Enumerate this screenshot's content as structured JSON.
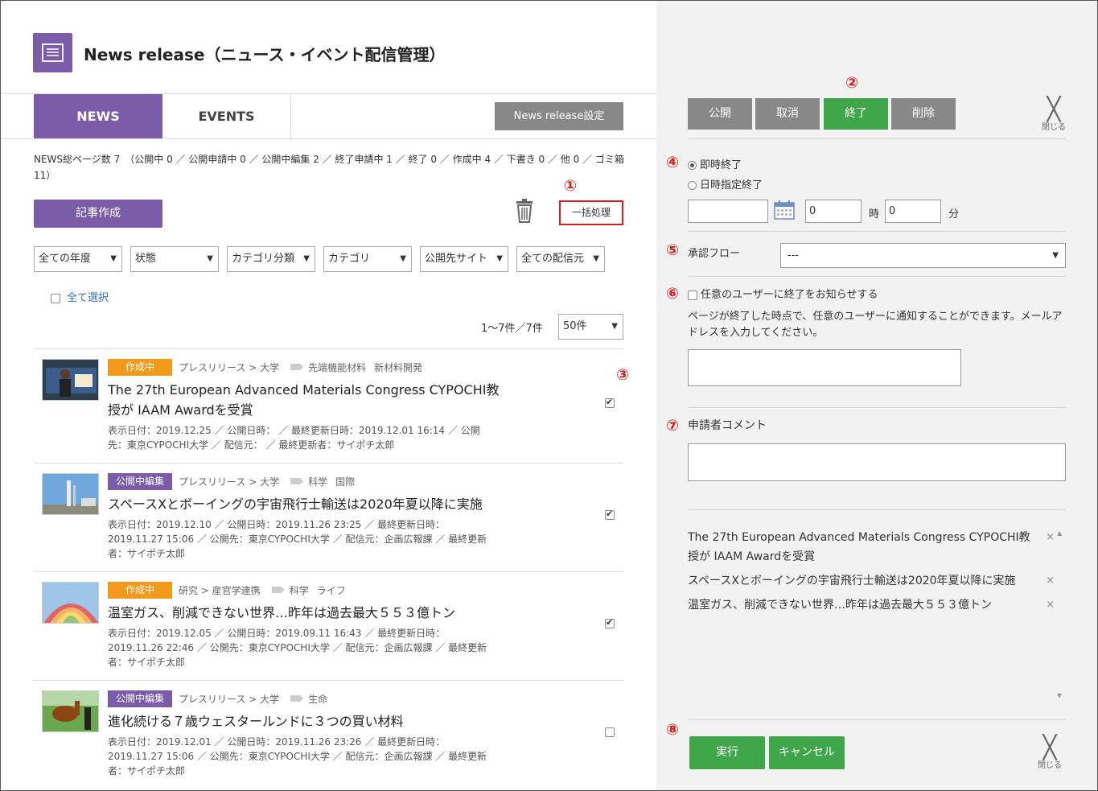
{
  "header": {
    "title": "News release（ニュース・イベント配信管理）"
  },
  "tabs": [
    {
      "label": "NEWS"
    },
    {
      "label": "EVENTS"
    }
  ],
  "settings_button": "News release設定",
  "summary": "NEWS総ページ数 7　（公開中 0 ／ 公開申請中 0 ／ 公開中編集 2 ／ 終了申請中 1 ／ 終了 0 ／ 作成中 4 ／ 下書き 0 ／ 他 0 ／ ゴミ箱 11）",
  "create_button": "記事作成",
  "bulk_button": "一括処理",
  "markers": [
    "①",
    "②",
    "③",
    "④",
    "⑤",
    "⑥",
    "⑦",
    "⑧"
  ],
  "filters": [
    "全ての年度",
    "状態",
    "カテゴリ分類",
    "カテゴリ",
    "公開先サイト",
    "全ての配信元"
  ],
  "select_all": "全て選択",
  "paging": {
    "text": "1〜7件／7件",
    "per_page": "50件"
  },
  "items": [
    {
      "status": "作成中",
      "status_color": "#f29a1b",
      "category": "プレスリリース > 大学",
      "tags": [
        "先端機能材料",
        "新材料開発"
      ],
      "title": "The 27th European Advanced Materials Congress CYPOCHI教授が IAAM Awardを受賞",
      "meta": "表示日付：2019.12.25 ／ 公開日時： ／ 最終更新日時：2019.12.01 16:14 ／ 公開先：東京CYPOCHI大学 ／ 配信元： ／ 最終更新者：サイポチ太郎",
      "checked": true
    },
    {
      "status": "公開中編集",
      "status_color": "#7b5ca8",
      "category": "プレスリリース > 大学",
      "tags": [
        "科学",
        "国際"
      ],
      "title": "スペースXとボーイングの宇宙飛行士輸送は2020年夏以降に実施",
      "meta": "表示日付：2019.12.10 ／ 公開日時：2019.11.26 23:25 ／ 最終更新日時：2019.11.27 15:06 ／ 公開先：東京CYPOCHI大学 ／ 配信元：企画広報課 ／ 最終更新者：サイポチ太郎",
      "checked": true
    },
    {
      "status": "作成中",
      "status_color": "#f29a1b",
      "category": "研究 > 産官学連携",
      "tags": [
        "科学",
        "ライフ"
      ],
      "title": "温室ガス、削減できない世界…昨年は過去最大５５３億トン",
      "meta": "表示日付：2019.12.05 ／ 公開日時：2019.09.11 16:43 ／ 最終更新日時：2019.11.26 22:46 ／ 公開先：東京CYPOCHI大学 ／ 配信元：企画広報課 ／ 最終更新者：サイポチ太郎",
      "checked": true
    },
    {
      "status": "公開中編集",
      "status_color": "#7b5ca8",
      "category": "プレスリリース > 大学",
      "tags": [
        "生命"
      ],
      "title": "進化続ける７歳ウェスタールンドに３つの買い材料",
      "meta": "表示日付：2019.12.01 ／ 公開日時：2019.11.26 23:26 ／ 最終更新日時：2019.11.27 15:06 ／ 公開先：東京CYPOCHI大学 ／ 配信元：企画広報課 ／ 最終更新者：サイポチ太郎",
      "checked": false
    }
  ],
  "panel": {
    "actions": [
      "公開",
      "取消",
      "終了",
      "削除"
    ],
    "close_label": "閉じる",
    "end_options": [
      "即時終了",
      "日時指定終了"
    ],
    "hour_value": "0",
    "hour_unit": "時",
    "minute_value": "0",
    "minute_unit": "分",
    "flow_label": "承認フロー",
    "flow_value": "---",
    "notify_label": "任意のユーザーに終了をお知らせする",
    "notify_help": "ページが終了した時点で、任意のユーザーに通知することができます。メールアドレスを入力してください。",
    "comment_label": "申請者コメント",
    "selected": [
      "The 27th European Advanced Materials Congress CYPOCHI教授が IAAM Awardを受賞",
      "スペースXとボーイングの宇宙飛行士輸送は2020年夏以降に実施",
      "温室ガス、削減できない世界…昨年は過去最大５５３億トン"
    ],
    "remove_symbol": "×",
    "execute_button": "実行",
    "cancel_button": "キャンセル"
  }
}
